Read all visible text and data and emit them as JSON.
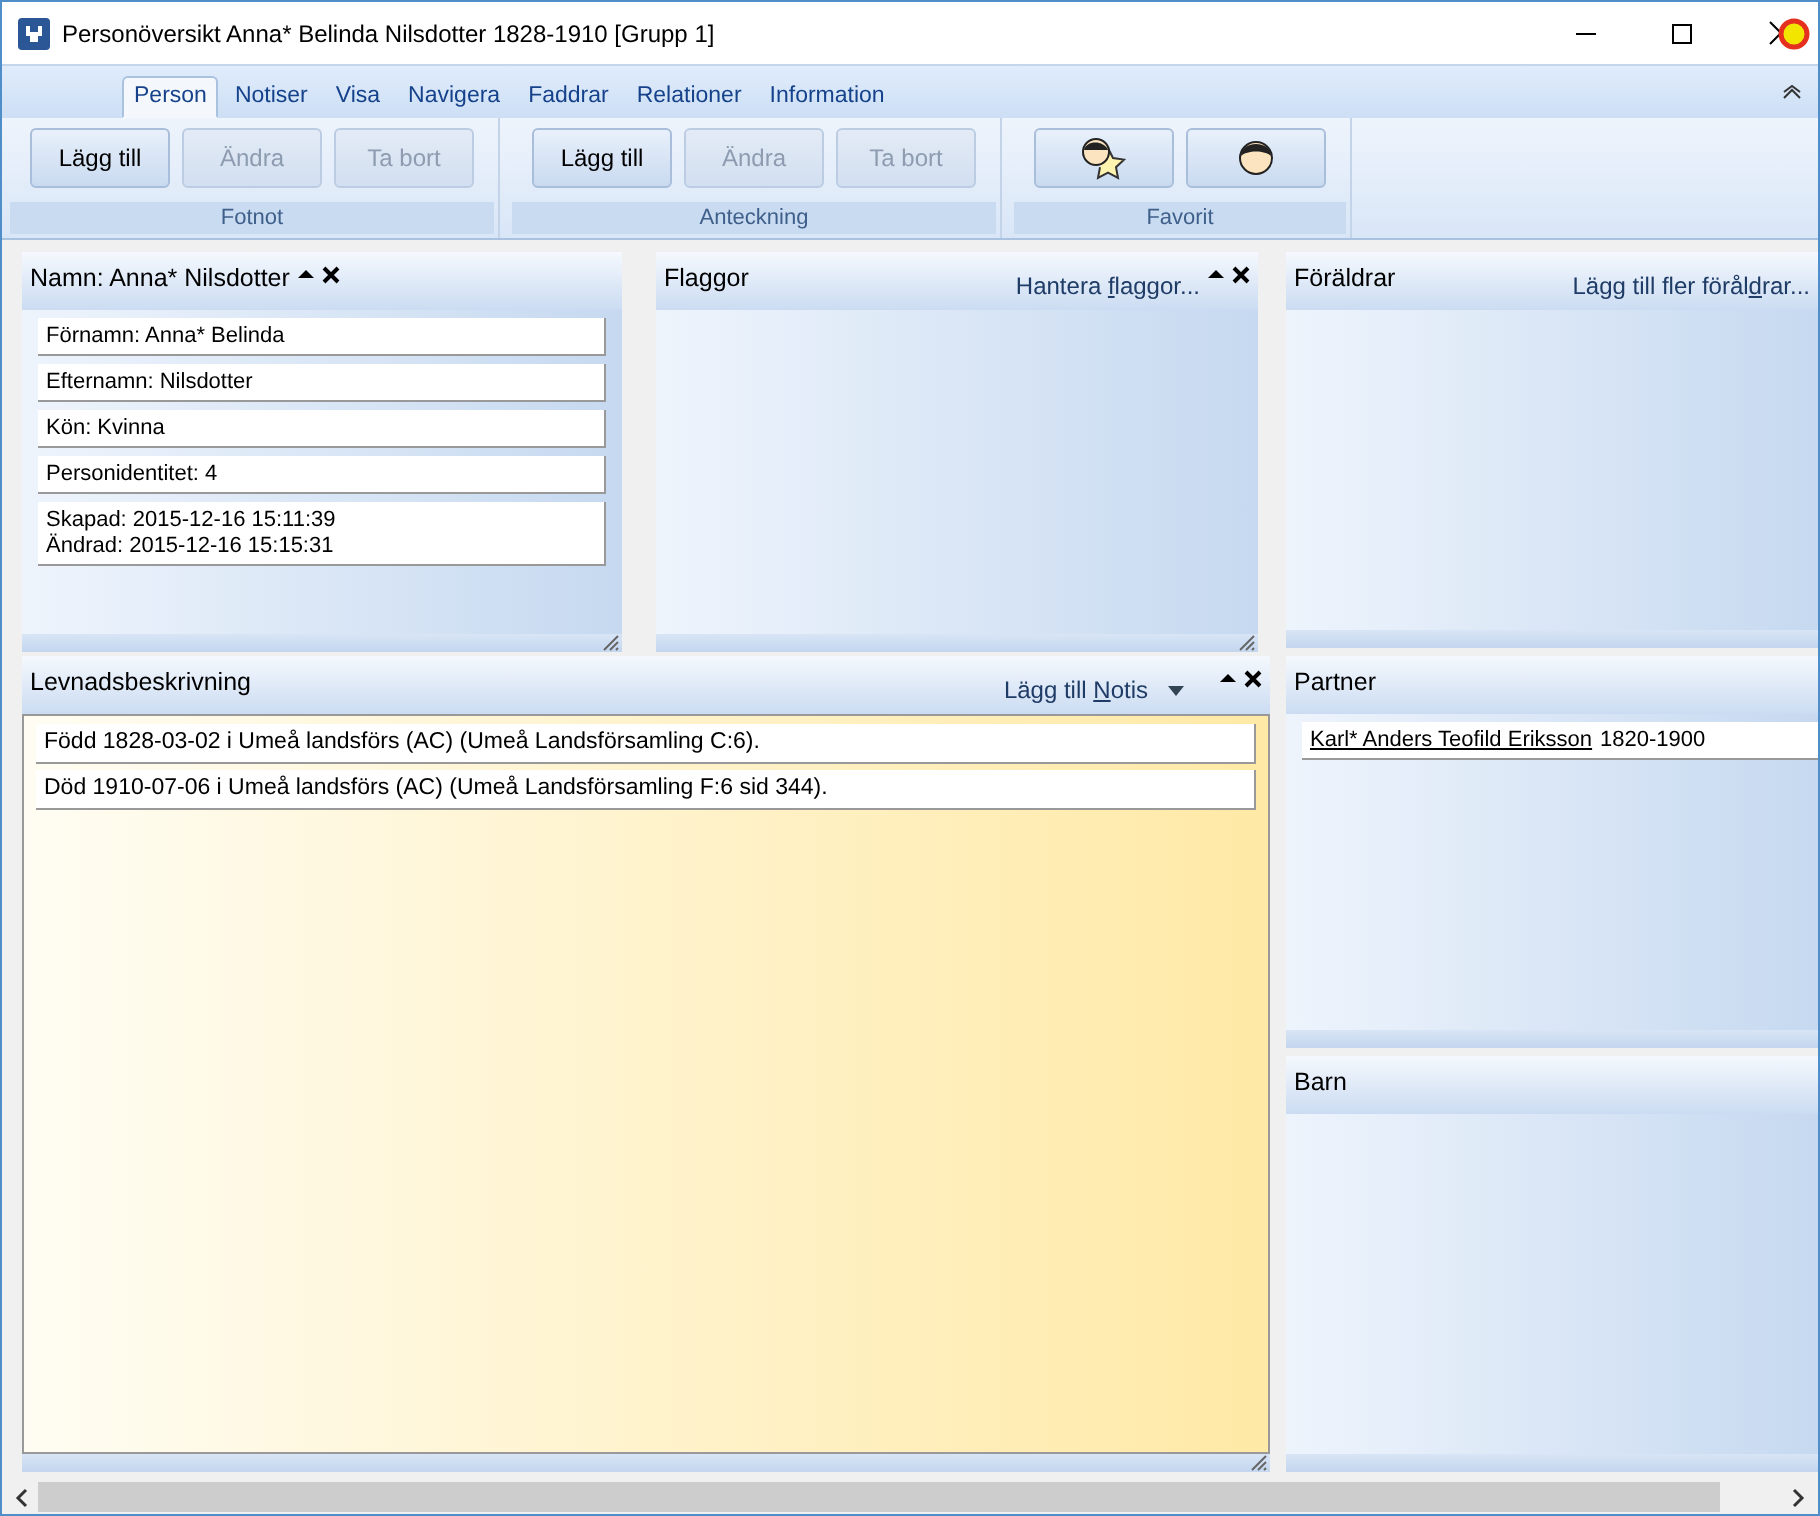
{
  "window": {
    "title": "Personöversikt Anna* Belinda Nilsdotter 1828-1910 [Grupp 1]"
  },
  "ribbon": {
    "tabs": [
      {
        "label": "Person",
        "selected": true
      },
      {
        "label": "Notiser",
        "selected": false
      },
      {
        "label": "Visa",
        "selected": false
      },
      {
        "label": "Navigera",
        "selected": false
      },
      {
        "label": "Faddrar",
        "selected": false
      },
      {
        "label": "Relationer",
        "selected": false
      },
      {
        "label": "Information",
        "selected": false
      }
    ],
    "groups": [
      {
        "caption": "Fotnot",
        "buttons": [
          {
            "kind": "text",
            "label": "Lägg till",
            "disabled": false
          },
          {
            "kind": "text",
            "label": "Ändra",
            "disabled": true
          },
          {
            "kind": "text",
            "label": "Ta bort",
            "disabled": true
          }
        ]
      },
      {
        "caption": "Anteckning",
        "buttons": [
          {
            "kind": "text",
            "label": "Lägg till",
            "disabled": false
          },
          {
            "kind": "text",
            "label": "Ändra",
            "disabled": true
          },
          {
            "kind": "text",
            "label": "Ta bort",
            "disabled": true
          }
        ]
      },
      {
        "caption": "Favorit",
        "buttons": [
          {
            "kind": "star-face",
            "disabled": false
          },
          {
            "kind": "face",
            "disabled": false
          }
        ]
      }
    ]
  },
  "name_panel": {
    "title": "Namn: Anna* Nilsdotter",
    "controls": true,
    "fields": [
      {
        "lines": [
          "Förnamn: Anna* Belinda"
        ]
      },
      {
        "lines": [
          "Efternamn: Nilsdotter"
        ]
      },
      {
        "lines": [
          "Kön: Kvinna"
        ]
      },
      {
        "lines": [
          "Personidentitet: 4"
        ]
      },
      {
        "lines": [
          "Skapad: 2015-12-16 15:11:39",
          "Ändrad: 2015-12-16 15:15:31"
        ]
      }
    ]
  },
  "flags_panel": {
    "title": "Flaggor",
    "controls": true,
    "action": {
      "pre": "Hantera ",
      "key": "f",
      "post": "laggor..."
    }
  },
  "parents_panel": {
    "title": "Föräldrar",
    "controls": false,
    "action": {
      "pre": "Lägg till fler förål",
      "key": "d",
      "post": "rar..."
    }
  },
  "biography_panel": {
    "title": "Levnadsbeskrivning",
    "controls": true,
    "action": {
      "pre": "Lägg till ",
      "key": "N",
      "post": "otis",
      "dropdown": true
    },
    "notes": [
      "Född 1828-03-02 i Umeå landsförs (AC) (Umeå Landsförsamling C:6).",
      "Död 1910-07-06 i Umeå landsförs (AC) (Umeå Landsförsamling F:6 sid  344)."
    ]
  },
  "partner_panel": {
    "title": "Partner",
    "controls": false,
    "partners": [
      {
        "name": "Karl* Anders Teofild Eriksson",
        "years": "1820-1900"
      }
    ]
  },
  "children_panel": {
    "title": "Barn",
    "controls": false
  }
}
